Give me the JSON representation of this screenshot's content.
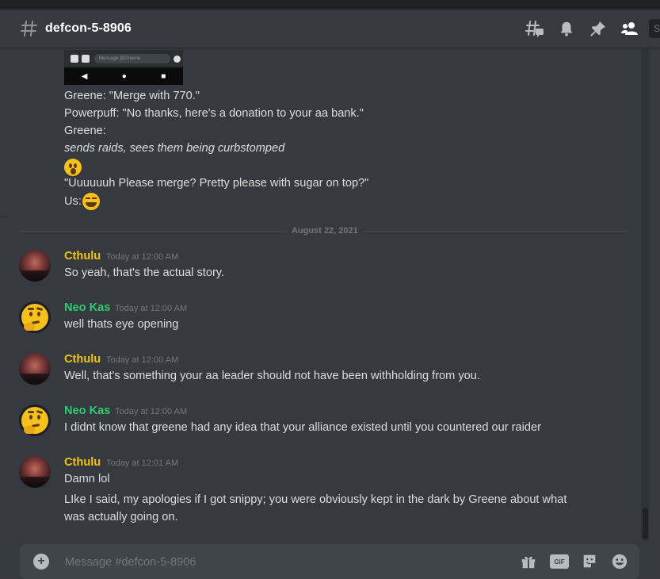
{
  "channel": {
    "name": "defcon-5-8906"
  },
  "header_tools": {
    "threads_icon": "threads-icon",
    "notifications_icon": "bell-icon",
    "pins_icon": "pin-icon",
    "members_icon": "members-icon",
    "search_stub": "S"
  },
  "embed": {
    "input_placeholder": "Message @Greene",
    "nav": [
      "◀",
      "●",
      "■"
    ]
  },
  "story_lines": [
    "Greene: \"Merge with 770.\"",
    "Powerpuff: \"No thanks, here's a donation to your aa bank.\"",
    "Greene:",
    "sends raids, sees them being curbstomped",
    "\"Uuuuuuh Please merge? Pretty please with sugar on top?\"",
    "Us:"
  ],
  "date_divider": "August 22, 2021",
  "messages": [
    {
      "author": "Cthulu",
      "timestamp": "Today at 12:00 AM",
      "lines": [
        "So yeah, that's the actual story."
      ]
    },
    {
      "author": "Neo Kas",
      "timestamp": "Today at 12:00 AM",
      "lines": [
        "well thats eye opening"
      ]
    },
    {
      "author": "Cthulu",
      "timestamp": "Today at 12:00 AM",
      "lines": [
        "Well, that's something your aa leader should not have been withholding from you."
      ]
    },
    {
      "author": "Neo Kas",
      "timestamp": "Today at 12:00 AM",
      "lines": [
        "I didnt know that greene had any idea that your alliance existed until you countered our raider"
      ]
    },
    {
      "author": "Cthulu",
      "timestamp": "Today at 12:01 AM",
      "lines": [
        "Damn lol",
        "LIke I said, my apologies if I got snippy; you were obviously kept in the dark by Greene about what",
        "was actually going on."
      ]
    }
  ],
  "composer": {
    "placeholder": "Message #defcon-5-8906",
    "gif_label": "GIF"
  },
  "colors": {
    "background": "#36393f",
    "cthulu_name": "#f1c40f",
    "neokas_name": "#2ecc71",
    "timestamp": "#72767d",
    "text": "#dcddde"
  }
}
